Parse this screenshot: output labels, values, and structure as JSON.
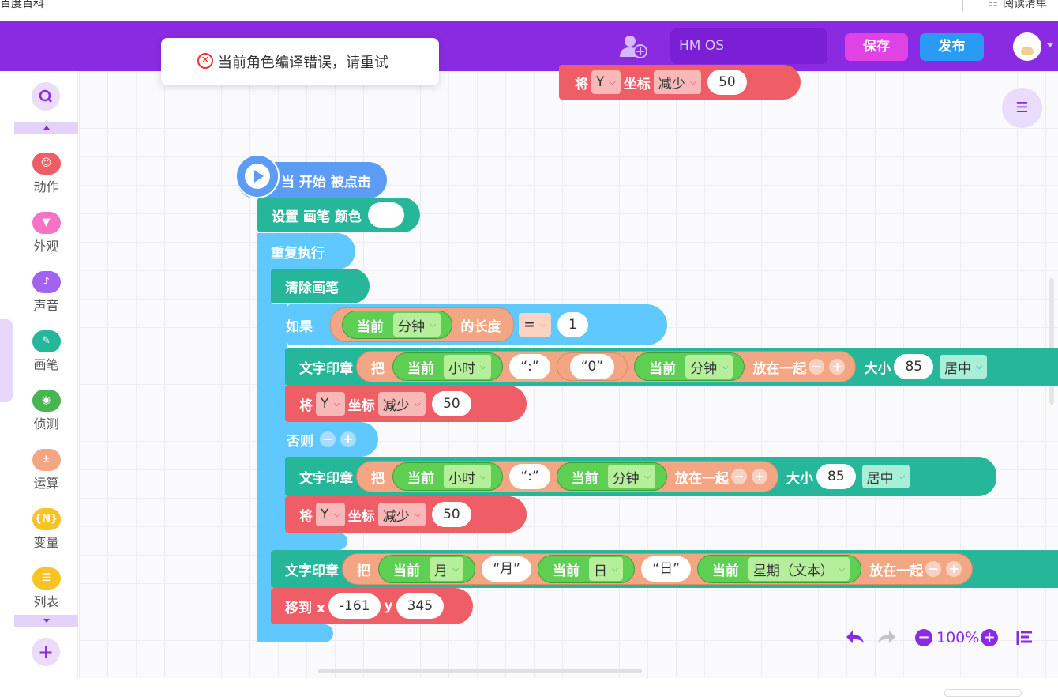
{
  "browser": {
    "left_text": "百度百科",
    "right_text": "阅读清单"
  },
  "header": {
    "os_name": "HM OS",
    "save_label": "保存",
    "publish_label": "发布"
  },
  "toast": {
    "message": "当前角色编译错误，请重试"
  },
  "sidebar": {
    "categories": [
      {
        "label": "动作",
        "color": "#ef5d66"
      },
      {
        "label": "外观",
        "color": "#f573c4"
      },
      {
        "label": "声音",
        "color": "#a462f0"
      },
      {
        "label": "画笔",
        "color": "#26b79b"
      },
      {
        "label": "侦测",
        "color": "#47b552"
      },
      {
        "label": "运算",
        "color": "#f3a683"
      },
      {
        "label": "变量",
        "icon_text": "{N}",
        "color": "#f9c323"
      },
      {
        "label": "列表",
        "color": "#f9c323"
      }
    ]
  },
  "zoom": {
    "level": "100%"
  },
  "blocks": {
    "top": {
      "kw1": "将",
      "axis": "Y",
      "kw2": "坐标",
      "op": "减少",
      "val": "50"
    },
    "hat": {
      "label": "当 开始 被点击"
    },
    "set_pen": {
      "label": "设置 画笔 颜色"
    },
    "repeat": {
      "label": "重复执行"
    },
    "clear": {
      "label": "清除画笔"
    },
    "if": {
      "kw": "如果",
      "cur": "当前",
      "unit": "分钟",
      "len": "的长度",
      "eq": "=",
      "num": "1"
    },
    "print1": {
      "kw": "文字印章",
      "ba": "把",
      "cur1": "当前",
      "u1": "小时",
      "colon": "“:”",
      "zero": "“0”",
      "cur2": "当前",
      "u2": "分钟",
      "join": "放在一起",
      "size": "大小",
      "sizeval": "85",
      "align": "居中"
    },
    "move1": {
      "kw1": "将",
      "axis": "Y",
      "kw2": "坐标",
      "op": "减少",
      "val": "50"
    },
    "else": {
      "kw": "否则"
    },
    "print2": {
      "kw": "文字印章",
      "ba": "把",
      "cur1": "当前",
      "u1": "小时",
      "colon": "“:”",
      "cur2": "当前",
      "u2": "分钟",
      "join": "放在一起",
      "size": "大小",
      "sizeval": "85",
      "align": "居中"
    },
    "move2": {
      "kw1": "将",
      "axis": "Y",
      "kw2": "坐标",
      "op": "减少",
      "val": "50"
    },
    "print3": {
      "kw": "文字印章",
      "ba": "把",
      "cur1": "当前",
      "u1": "月",
      "s1": "“月”",
      "cur2": "当前",
      "u2": "日",
      "s2": "“日”",
      "cur3": "当前",
      "u3": "星期（文本）",
      "join": "放在一起"
    },
    "goto": {
      "kw": "移到 x",
      "x": "-161",
      "ykw": "y",
      "y": "345"
    }
  }
}
